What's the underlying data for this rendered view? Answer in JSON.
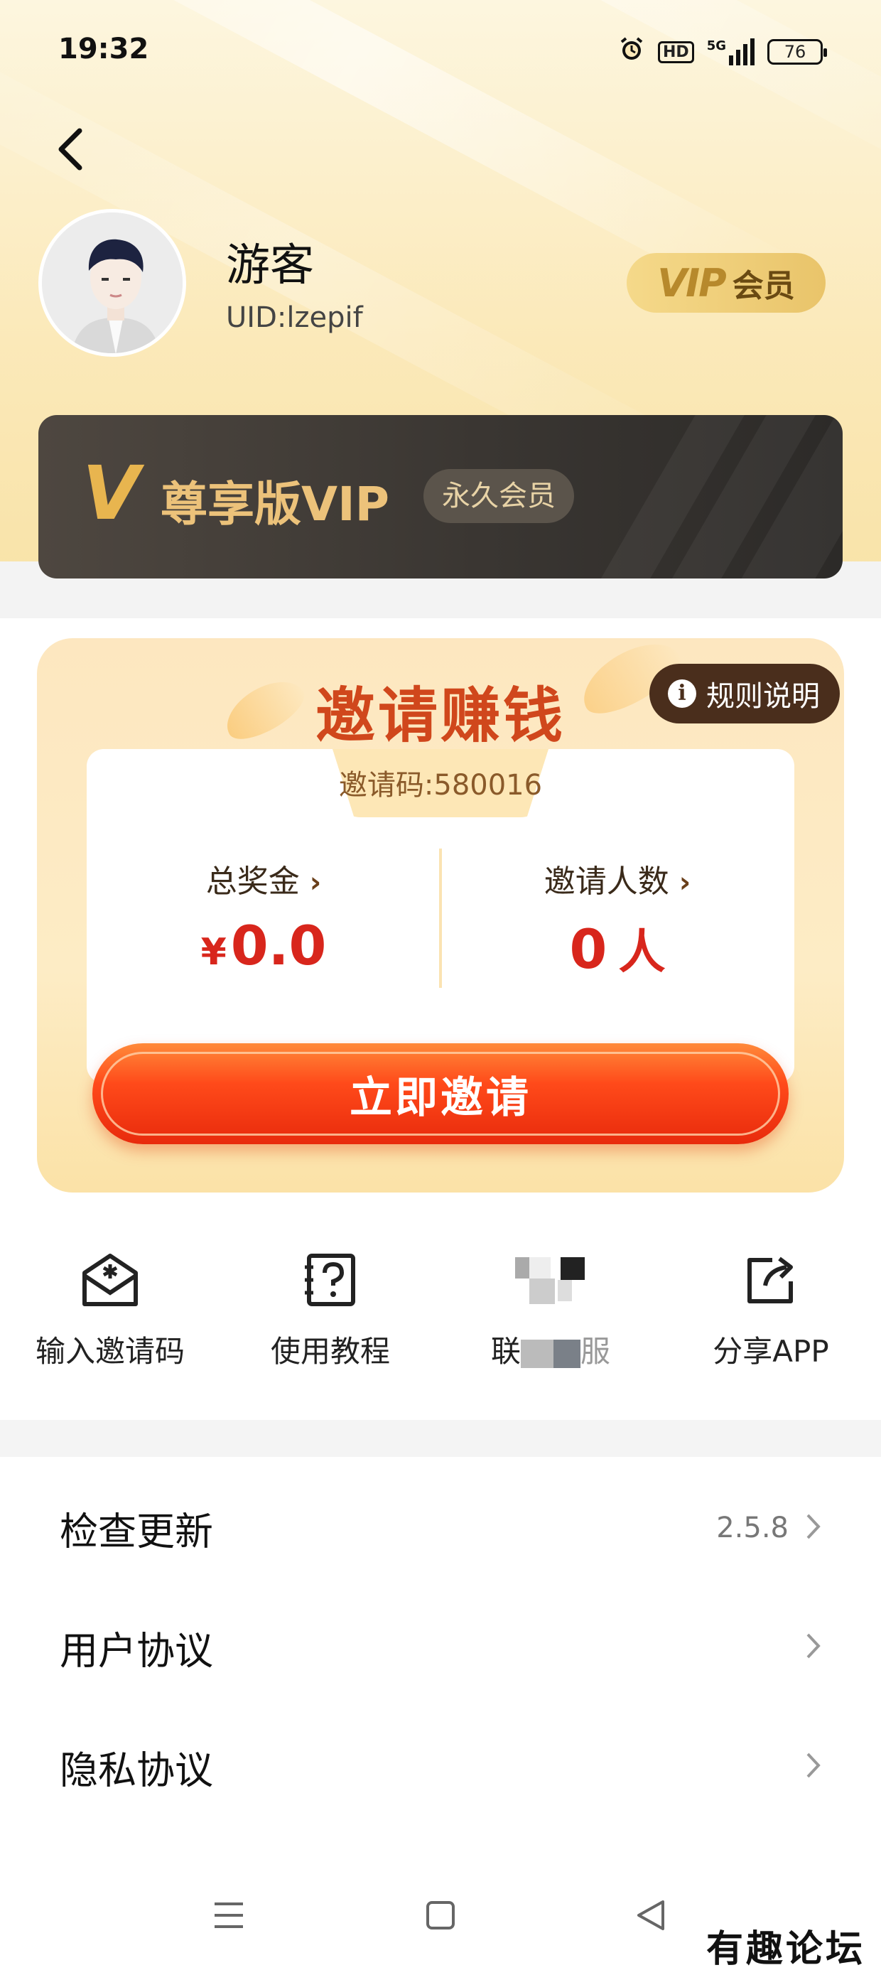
{
  "status_bar": {
    "time": "19:32",
    "hd": "HD",
    "network": "5G",
    "battery": "76"
  },
  "profile": {
    "name": "游客",
    "uid": "UID:lzepif",
    "vip_badge_word": "VIP",
    "vip_badge_label": "会员"
  },
  "vip_card": {
    "v_mark": "V",
    "title": "尊享版VIP",
    "tag": "永久会员"
  },
  "invite": {
    "title": "邀请赚钱",
    "rules_label": "规则说明",
    "code_text": "邀请码:580016",
    "reward_label": "总奖金",
    "reward_currency": "¥",
    "reward_value": "0.0",
    "invitees_label": "邀请人数",
    "invitees_value": "0",
    "invitees_unit": "人",
    "button_label": "立即邀请"
  },
  "shortcuts": [
    {
      "label": "输入邀请码",
      "icon": "envelope-icon"
    },
    {
      "label": "使用教程",
      "icon": "help-book-icon"
    },
    {
      "label_a": "联",
      "label_b": "服",
      "icon": "customer-service-icon"
    },
    {
      "label": "分享APP",
      "icon": "share-icon"
    }
  ],
  "settings_list": [
    {
      "title": "检查更新",
      "value": "2.5.8"
    },
    {
      "title": "用户协议"
    },
    {
      "title": "隐私协议"
    }
  ],
  "watermark": "有趣论坛"
}
